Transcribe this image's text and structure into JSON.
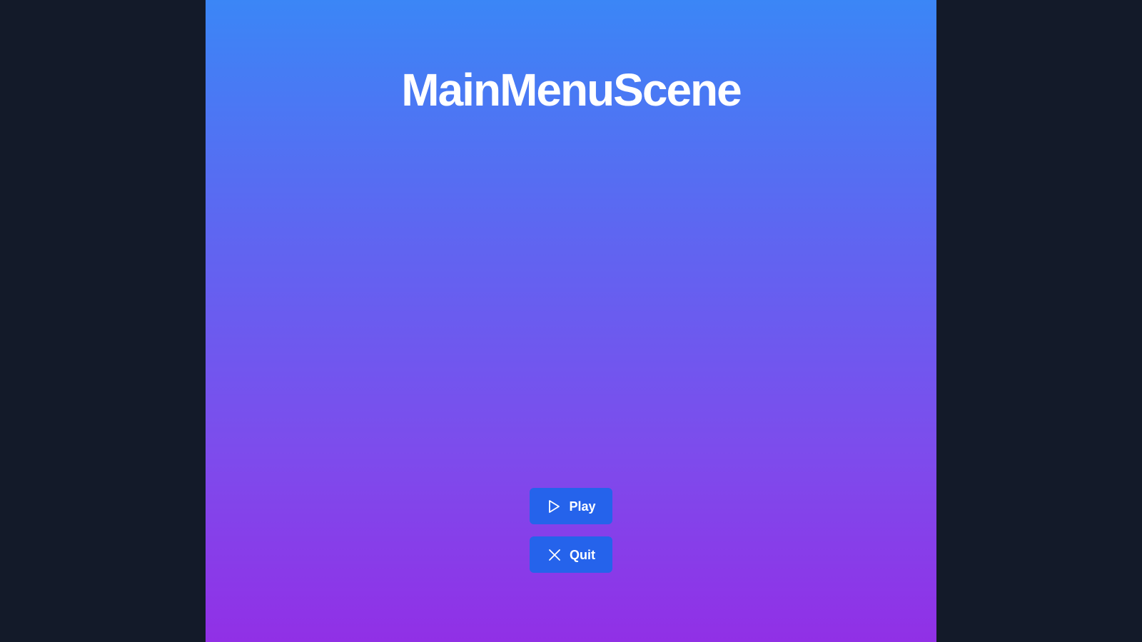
{
  "scene": {
    "title": "MainMenuScene"
  },
  "menu": {
    "buttons": [
      {
        "label": "Play",
        "icon": "play-icon"
      },
      {
        "label": "Quit",
        "icon": "close-icon"
      }
    ]
  },
  "colors": {
    "backdrop": "#131a29",
    "gradient_top": "#3b86f6",
    "gradient_bottom": "#9130e6",
    "button": "#2563eb",
    "text": "#ffffff"
  }
}
